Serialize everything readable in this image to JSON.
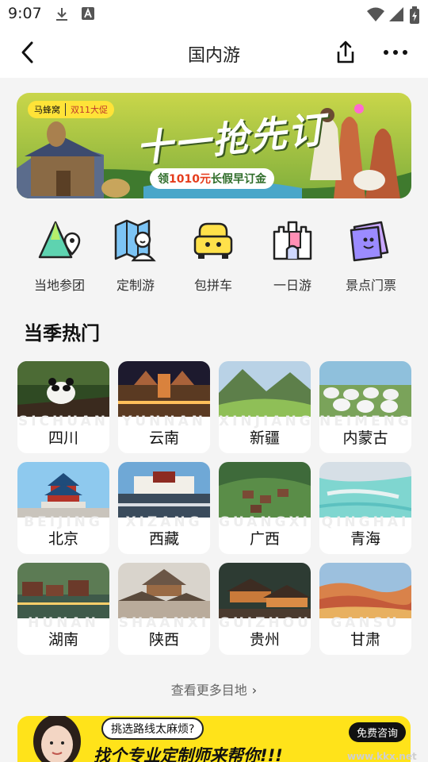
{
  "status": {
    "time": "9:07"
  },
  "nav": {
    "title": "国内游"
  },
  "banner": {
    "badge_brand": "马蜂窝",
    "badge_tag": "双11大促",
    "headline": "十一抢先订",
    "pill_prefix": "领",
    "pill_amount": "1010元",
    "pill_suffix": "长假早订金"
  },
  "quick_links": [
    {
      "label": "当地参团",
      "icon": "mountain-pin-icon"
    },
    {
      "label": "定制游",
      "icon": "map-person-icon"
    },
    {
      "label": "包拼车",
      "icon": "car-icon"
    },
    {
      "label": "一日游",
      "icon": "castle-icon"
    },
    {
      "label": "景点门票",
      "icon": "ticket-icon"
    }
  ],
  "section": {
    "title": "当季热门"
  },
  "destinations": [
    {
      "name": "四川",
      "pinyin": "SICHUAN"
    },
    {
      "name": "云南",
      "pinyin": "YUNNAN"
    },
    {
      "name": "新疆",
      "pinyin": "XINJIANG"
    },
    {
      "name": "内蒙古",
      "pinyin": "NEIMENG"
    },
    {
      "name": "北京",
      "pinyin": "BEIJING"
    },
    {
      "name": "西藏",
      "pinyin": "XIZANG"
    },
    {
      "name": "广西",
      "pinyin": "GUANGXI"
    },
    {
      "name": "青海",
      "pinyin": "QINGHAI"
    },
    {
      "name": "湖南",
      "pinyin": "HUNAN"
    },
    {
      "name": "陕西",
      "pinyin": "SHAANXI"
    },
    {
      "name": "贵州",
      "pinyin": "GUIZHOU"
    },
    {
      "name": "甘肃",
      "pinyin": "GANSU"
    }
  ],
  "more_link": {
    "label": "查看更多目地"
  },
  "promo": {
    "bubble": "挑选路线太麻烦?",
    "slogan": "找个专业定制师来帮你!!!",
    "cta": "免费咨询"
  },
  "watermark": {
    "text": "www.kkx.net"
  },
  "colors": {
    "accent_yellow": "#ffe31a",
    "text_primary": "#111111",
    "background": "#f4f4f4"
  }
}
